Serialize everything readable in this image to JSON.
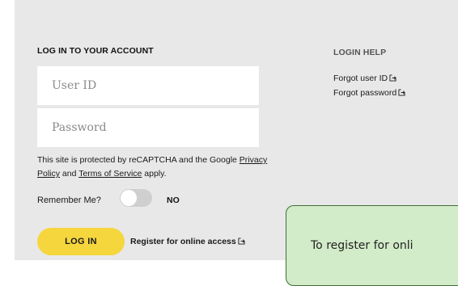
{
  "login": {
    "heading": "LOG IN TO YOUR ACCOUNT",
    "user_id_placeholder": "User ID",
    "password_placeholder": "Password",
    "recaptcha_prefix": "This site is protected by reCAPTCHA and the Google ",
    "privacy_policy": "Privacy Policy",
    "and": " and ",
    "terms": "Terms of Service",
    "recaptcha_suffix": " apply.",
    "remember_label": "Remember Me?",
    "remember_state": "NO",
    "login_button": "LOG IN",
    "register_link": "Register for online access"
  },
  "help": {
    "heading": "LOGIN HELP",
    "forgot_user": "Forgot user ID",
    "forgot_password": "Forgot password"
  },
  "tooltip": {
    "text": "To register for onli"
  },
  "colors": {
    "panel": "#e8e8e8",
    "button": "#f5d63d",
    "tooltip_bg": "#d2ebc8",
    "tooltip_border": "#3f6e38"
  },
  "icons": {
    "external": "external-link-icon"
  }
}
